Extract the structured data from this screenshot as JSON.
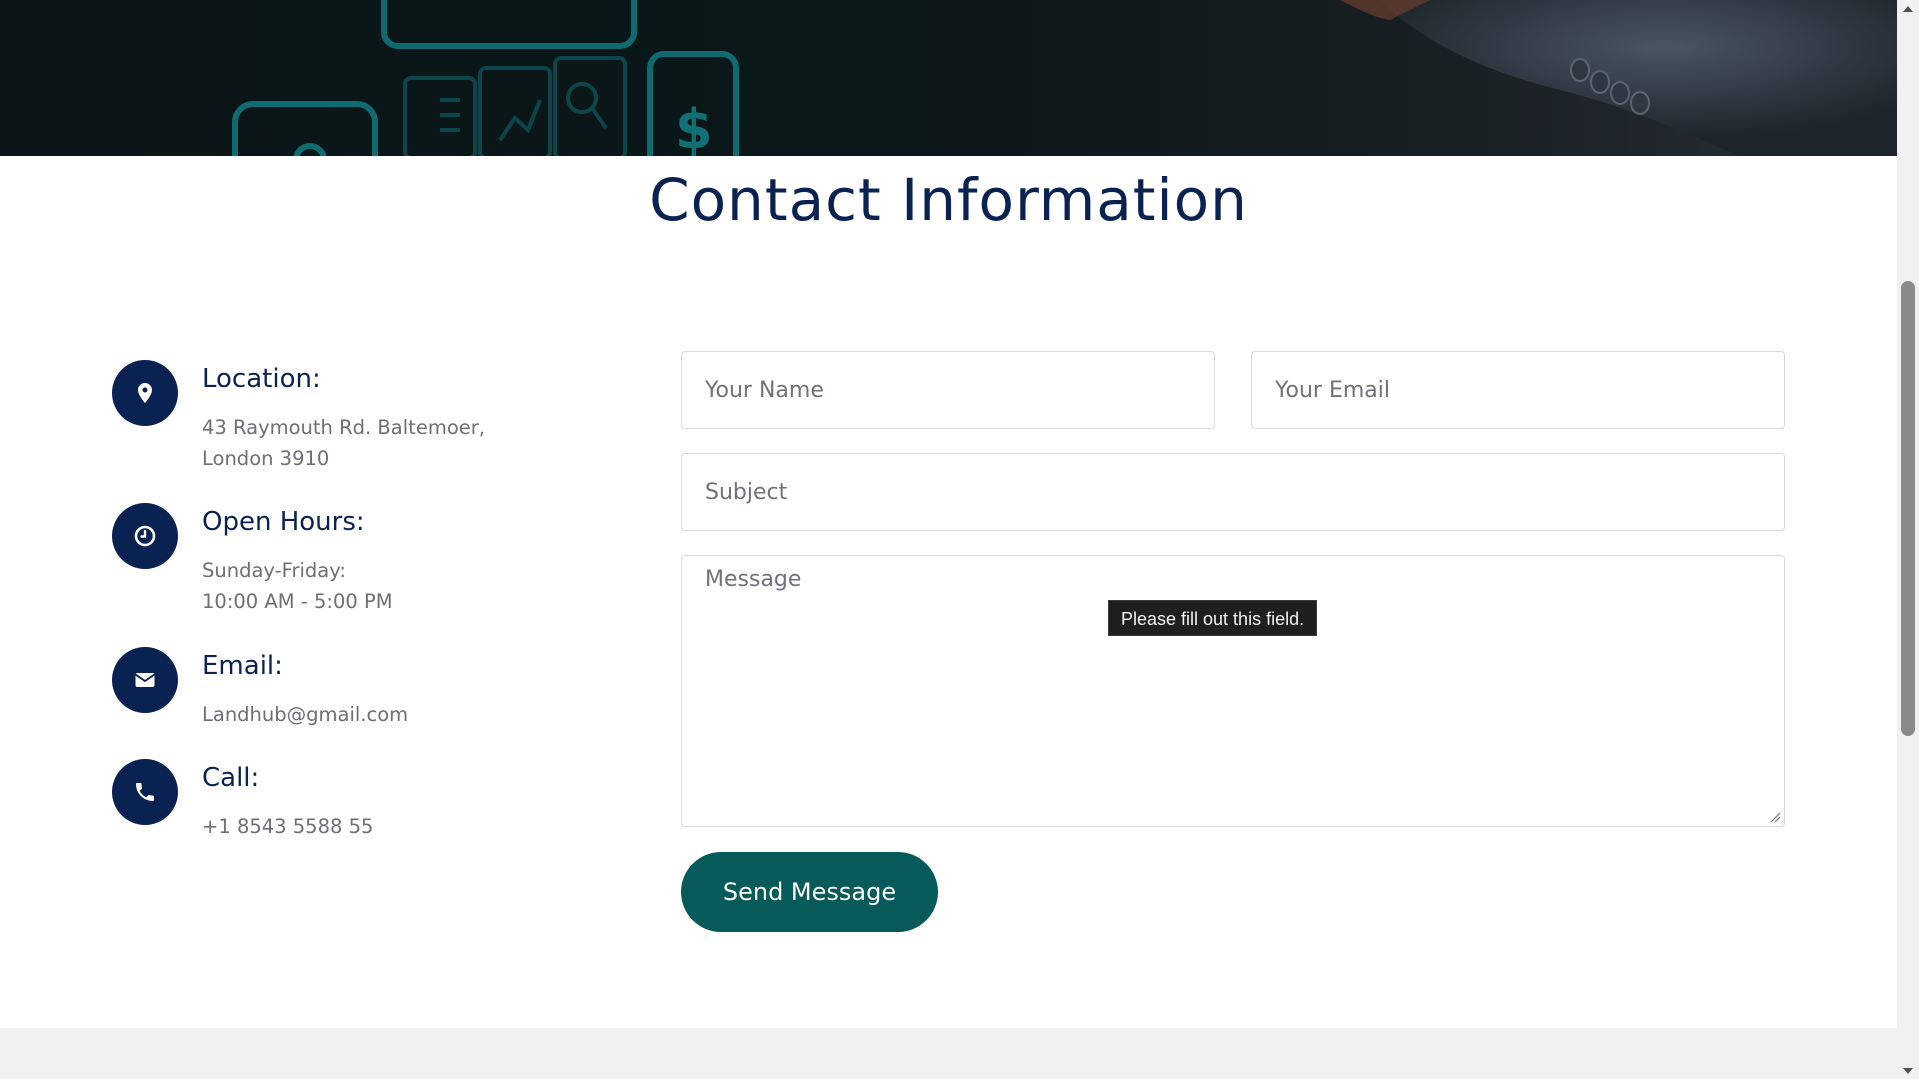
{
  "page": {
    "title": "Contact Information"
  },
  "contact_info": [
    {
      "icon": "map-pin-icon",
      "heading": "Location:",
      "lines": [
        "43 Raymouth Rd. Baltemoer,",
        "London 3910"
      ]
    },
    {
      "icon": "clock-icon",
      "heading": "Open Hours:",
      "lines": [
        "Sunday-Friday:",
        "10:00 AM - 5:00 PM"
      ]
    },
    {
      "icon": "envelope-icon",
      "heading": "Email:",
      "lines": [
        "Landhub@gmail.com"
      ]
    },
    {
      "icon": "phone-icon",
      "heading": "Call:",
      "lines": [
        "+1 8543 5588 55"
      ]
    }
  ],
  "form": {
    "name_placeholder": "Your Name",
    "email_placeholder": "Your Email",
    "subject_placeholder": "Subject",
    "message_placeholder": "Message",
    "name_value": "",
    "email_value": "",
    "subject_value": "",
    "message_value": "",
    "submit_label": "Send Message"
  },
  "validation_tooltip": {
    "text": "Please fill out this field."
  },
  "colors": {
    "navy": "#0a2251",
    "teal_button": "#065a5a",
    "muted_text": "#6b6f78",
    "tooltip_bg": "#1f1f1f",
    "footer_band": "#f1f1f1"
  }
}
